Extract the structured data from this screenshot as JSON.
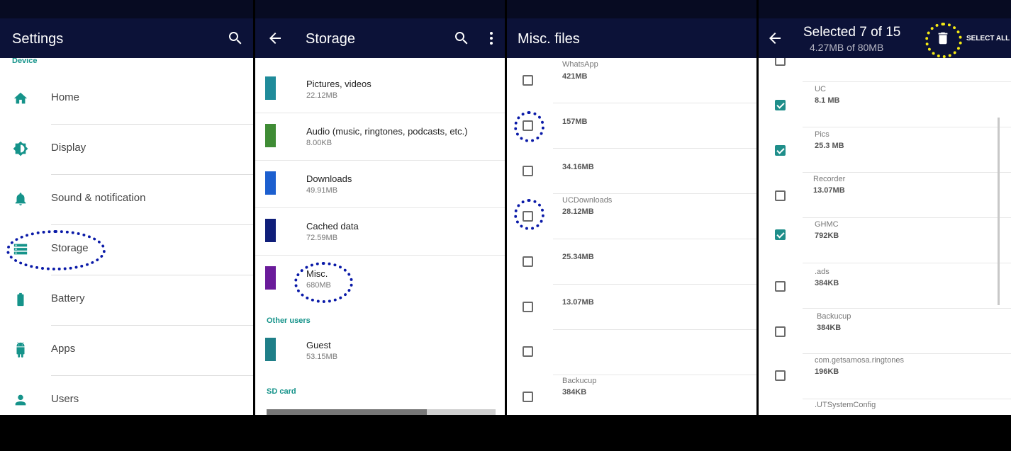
{
  "settings": {
    "title": "Settings",
    "section": "Device",
    "items": [
      {
        "label": "Home",
        "icon": "home-icon"
      },
      {
        "label": "Display",
        "icon": "display-icon"
      },
      {
        "label": "Sound & notification",
        "icon": "bell-icon"
      },
      {
        "label": "Storage",
        "icon": "storage-icon"
      },
      {
        "label": "Battery",
        "icon": "battery-icon"
      },
      {
        "label": "Apps",
        "icon": "android-icon"
      },
      {
        "label": "Users",
        "icon": "user-icon"
      }
    ],
    "accent": "#15938a"
  },
  "storage": {
    "title": "Storage",
    "items": [
      {
        "name": "Pictures, videos",
        "size": "22.12MB",
        "color": "#1f8b9a"
      },
      {
        "name": "Audio (music, ringtones, podcasts, etc.)",
        "size": "8.00KB",
        "color": "#3f8c35"
      },
      {
        "name": "Downloads",
        "size": "49.91MB",
        "color": "#1c5fcf"
      },
      {
        "name": "Cached data",
        "size": "72.59MB",
        "color": "#0f1e79"
      },
      {
        "name": "Misc.",
        "size": "680MB",
        "color": "#6a1b9a"
      }
    ],
    "other_users_header": "Other users",
    "guest": {
      "name": "Guest",
      "size": "53.15MB",
      "color": "#1f7f88"
    },
    "sd_card_header": "SD card",
    "sd_used": 0.7
  },
  "misc": {
    "title": "Misc. files",
    "rows": [
      {
        "name": "WhatsApp",
        "size": "421MB"
      },
      {
        "name": "",
        "size": "157MB"
      },
      {
        "name": "",
        "size": "34.16MB"
      },
      {
        "name": "UCDownloads",
        "size": "28.12MB"
      },
      {
        "name": "",
        "size": "25.34MB"
      },
      {
        "name": "",
        "size": "13.07MB"
      },
      {
        "name": "",
        "size": ""
      },
      {
        "name": "Backucup",
        "size": "384KB"
      }
    ]
  },
  "selection": {
    "title": "Selected 7 of 15",
    "subtitle": "4.27MB of  80MB",
    "select_all": "SELECT ALL",
    "rows": [
      {
        "name": "UC",
        "size": "8.1  MB",
        "checked": true
      },
      {
        "name": "Pics",
        "size": "25.3  MB",
        "checked": true
      },
      {
        "name": "Recorder",
        "size": "13.07MB",
        "checked": false
      },
      {
        "name": "GHMC",
        "size": "792KB",
        "checked": true
      },
      {
        "name": ".ads",
        "size": "384KB",
        "checked": false
      },
      {
        "name": "Backucup",
        "size": "384KB",
        "checked": false
      },
      {
        "name": "com.getsamosa.ringtones",
        "size": "196KB",
        "checked": false
      },
      {
        "name": ".UTSystemConfig",
        "size": "",
        "checked": false
      }
    ]
  }
}
